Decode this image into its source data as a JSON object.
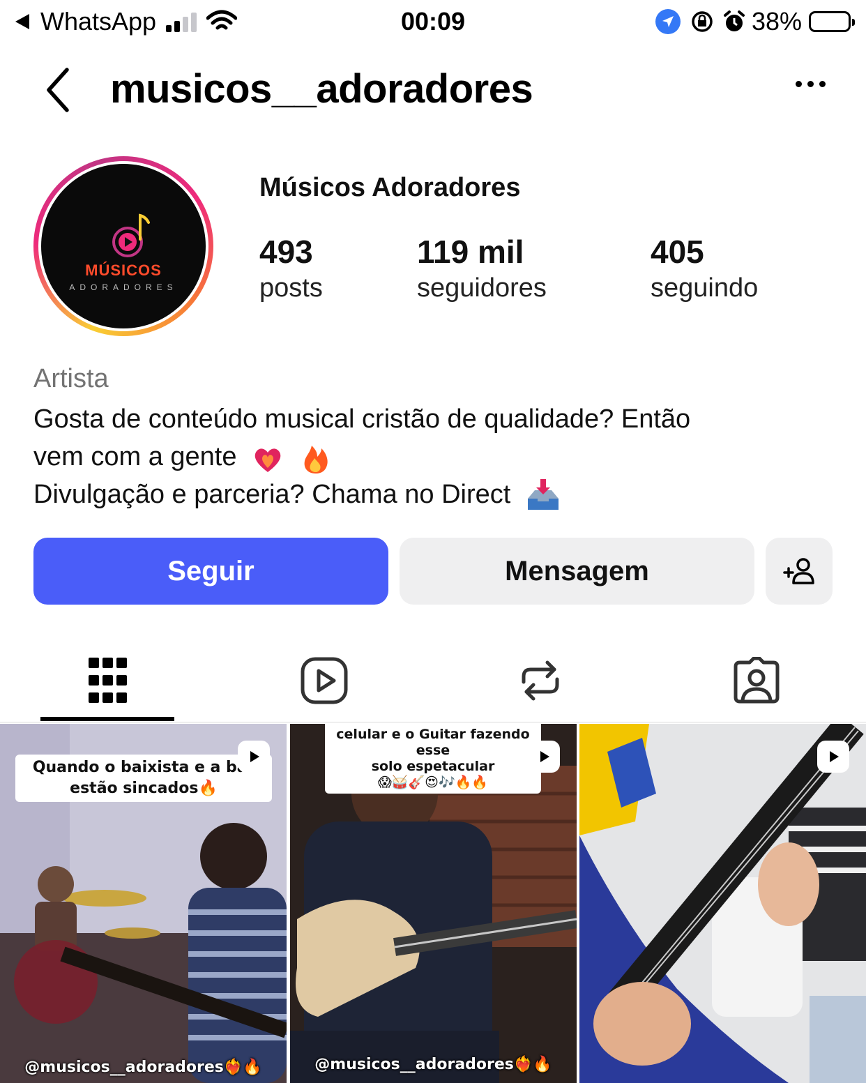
{
  "status_bar": {
    "back_app": "WhatsApp",
    "time": "00:09",
    "battery": "38%"
  },
  "header": {
    "username": "musicos__adoradores"
  },
  "profile": {
    "display_name": "Músicos Adoradores",
    "avatar_logo_text": "MÚSICOS",
    "avatar_logo_sub": "ADORADORES",
    "stats": [
      {
        "value": "493",
        "label": "posts"
      },
      {
        "value": "119 mil",
        "label": "seguidores"
      },
      {
        "value": "405",
        "label": "seguindo"
      }
    ],
    "category": "Artista",
    "bio_lines": [
      "Gosta de conteúdo musical cristão de qualidade? Então",
      "vem com a gente",
      "Divulgação e parceria? Chama no Direct"
    ]
  },
  "actions": {
    "follow": "Seguir",
    "message": "Mensagem"
  },
  "tabs": [
    {
      "name": "posts-grid",
      "icon": "grid-icon"
    },
    {
      "name": "reels",
      "icon": "reels-icon"
    },
    {
      "name": "reposts",
      "icon": "repost-icon"
    },
    {
      "name": "tagged",
      "icon": "tagged-person-icon"
    }
  ],
  "posts": [
    {
      "caption_lines": [
        "Quando o baixista e a bat",
        "estão sincados🔥"
      ],
      "handle": "@musicos__adoradores❤️‍🔥🔥"
    },
    {
      "caption_lines": [
        "celular e o Guitar fazendo esse",
        "solo espetacular",
        "😱🥁🎸😍🎶🔥🔥"
      ],
      "handle": "@musicos__adoradores❤️‍🔥🔥"
    },
    {
      "caption_lines": [],
      "handle": ""
    }
  ],
  "colors": {
    "follow_button": "#4a5df9",
    "secondary_button": "#efeff0",
    "muted_text": "#737373"
  }
}
